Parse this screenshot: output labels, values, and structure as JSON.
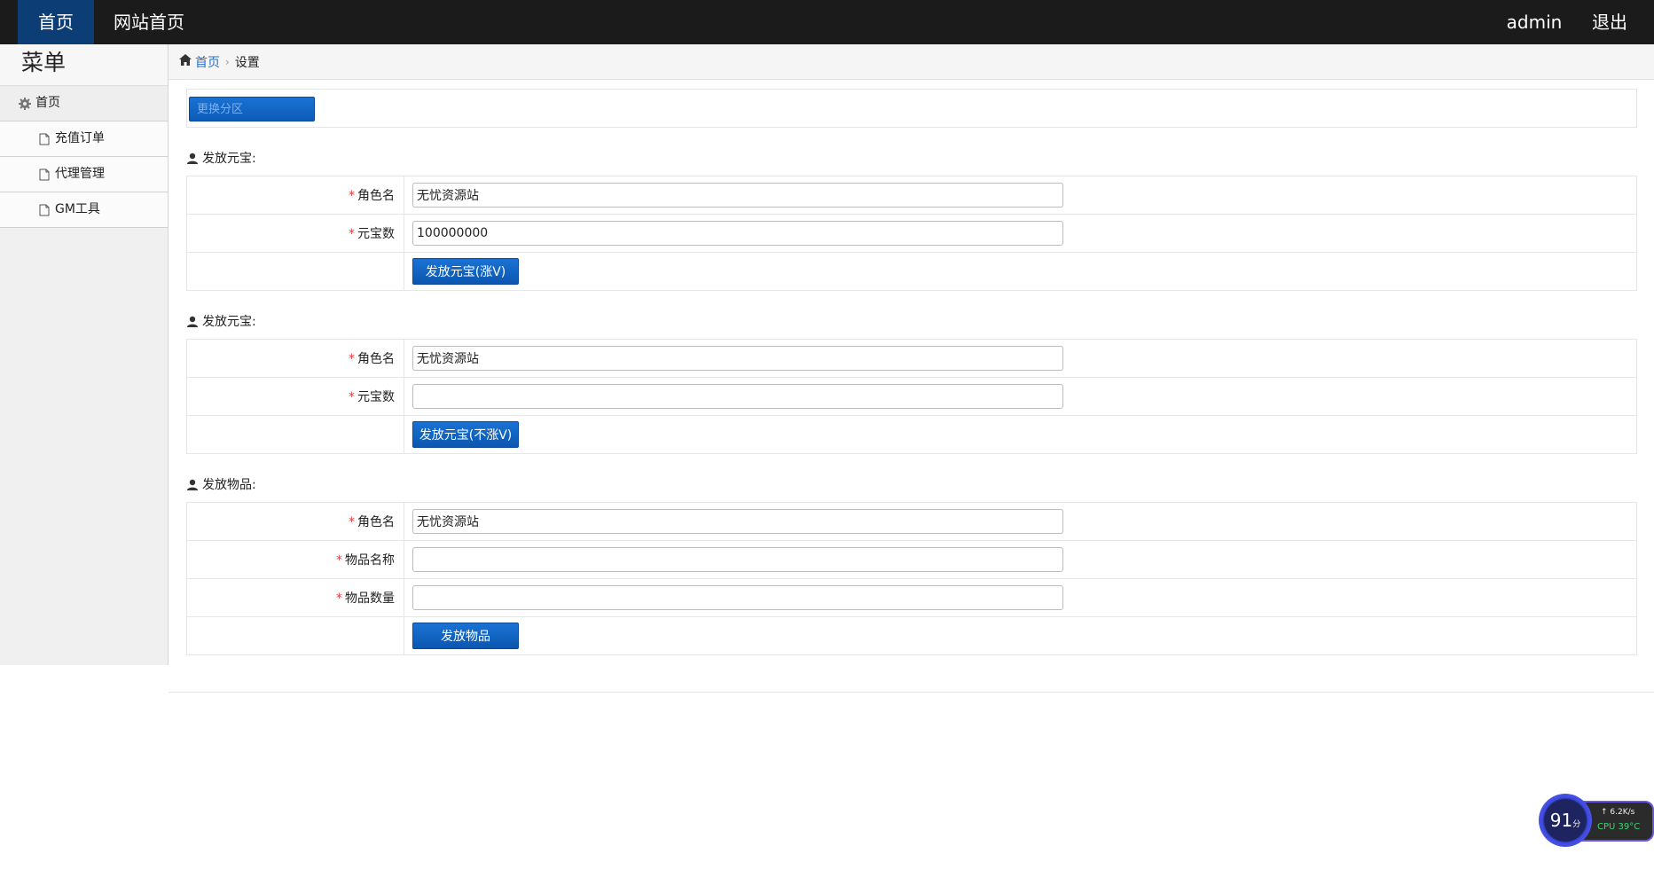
{
  "nav": {
    "home": "首页",
    "site_home": "网站首页",
    "user": "admin",
    "logout": "退出"
  },
  "sidebar": {
    "title": "菜单",
    "items": [
      {
        "label": "首页",
        "icon": "gear-icon"
      },
      {
        "label": "充值订单",
        "icon": "file-icon"
      },
      {
        "label": "代理管理",
        "icon": "file-icon"
      },
      {
        "label": "GM工具",
        "icon": "file-icon"
      }
    ]
  },
  "breadcrumb": {
    "home": "首页",
    "current": "设置"
  },
  "switch_button": "更换分区",
  "sections": [
    {
      "title": "发放元宝:",
      "rows": [
        {
          "label": "角色名",
          "value": "无忧资源站"
        },
        {
          "label": "元宝数",
          "value": "100000000"
        }
      ],
      "button": "发放元宝(涨V)"
    },
    {
      "title": "发放元宝:",
      "rows": [
        {
          "label": "角色名",
          "value": "无忧资源站"
        },
        {
          "label": "元宝数",
          "value": ""
        }
      ],
      "button": "发放元宝(不涨V)"
    },
    {
      "title": "发放物品:",
      "rows": [
        {
          "label": "角色名",
          "value": "无忧资源站"
        },
        {
          "label": "物品名称",
          "value": ""
        },
        {
          "label": "物品数量",
          "value": ""
        }
      ],
      "button": "发放物品"
    }
  ],
  "widget": {
    "score": "91",
    "score_unit": "分",
    "net": "6.2K/s",
    "cpu": "CPU 39°C",
    "accent": "#6a55e6",
    "cpu_color": "#2fdc6a"
  },
  "colors": {
    "topbar": "#1b1b1b",
    "nav_active": "#0c3d74",
    "button": "#0d5bb8",
    "link": "#2a6fc4",
    "required": "#e4393c"
  }
}
